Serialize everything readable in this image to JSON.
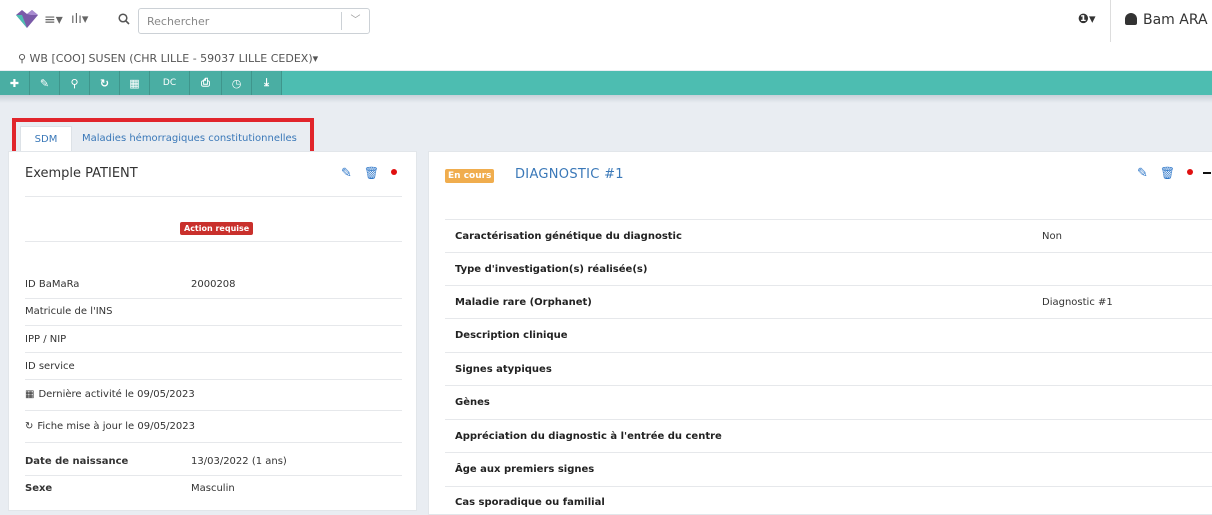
{
  "header": {
    "search_placeholder": "Rechercher",
    "search_dropdown": "﹀",
    "help": "❶▾",
    "user_name": "Bam ARA",
    "location": "⚲ WB [COO] SUSEN (CHR LILLE - 59037 LILLE CEDEX)▾",
    "menu_icon": "≡▾",
    "chart_icon": "ılı▾",
    "search_icon": "🔍"
  },
  "toolbar": {
    "buttons": [
      {
        "label": "✚"
      },
      {
        "label": "✎"
      },
      {
        "label": "⚲"
      },
      {
        "label": "↻"
      },
      {
        "label": "▦"
      },
      {
        "label": "DC"
      },
      {
        "label": "⎙"
      },
      {
        "label": "◷"
      },
      {
        "label": "⤓"
      }
    ]
  },
  "tabs": [
    {
      "label": "SDM"
    },
    {
      "label": "Maladies hémorragiques constitutionnelles"
    }
  ],
  "patient": {
    "name": "Exemple PATIENT",
    "action_badge": "Action requise",
    "fields": [
      {
        "label": "ID BaMaRa",
        "value": "2000208"
      },
      {
        "label": "Matricule de l'INS",
        "value": ""
      },
      {
        "label": "IPP / NIP",
        "value": ""
      },
      {
        "label": "ID service",
        "value": ""
      }
    ],
    "last_activity": "Dernière activité le  09/05/2023",
    "last_update": "Fiche mise à jour le  09/05/2023",
    "birth_label": "Date de naissance",
    "birth_value": "13/03/2022 (1 ans)",
    "sex_label": "Sexe",
    "sex_value": "Masculin"
  },
  "diagnostic": {
    "status_badge": "En cours",
    "title": "DIAGNOSTIC #1",
    "rows": [
      {
        "label": "Caractérisation génétique du diagnostic",
        "value": "Non"
      },
      {
        "label": "Type d'investigation(s) réalisée(s)",
        "value": ""
      },
      {
        "label": "Maladie rare (Orphanet)",
        "value": "Diagnostic #1"
      },
      {
        "label": "Description clinique",
        "value": ""
      },
      {
        "label": "Signes atypiques",
        "value": ""
      },
      {
        "label": "Gènes",
        "value": ""
      },
      {
        "label": "Appréciation du diagnostic à l'entrée du centre",
        "value": ""
      },
      {
        "label": "Âge aux premiers signes",
        "value": ""
      },
      {
        "label": "Cas sporadique ou familial",
        "value": ""
      }
    ]
  },
  "colors": {
    "toolbar": "#4dbdb1",
    "link": "#3a78b8",
    "danger": "#c9302c",
    "warning": "#f0ad4e",
    "highlight": "#e1252b"
  }
}
